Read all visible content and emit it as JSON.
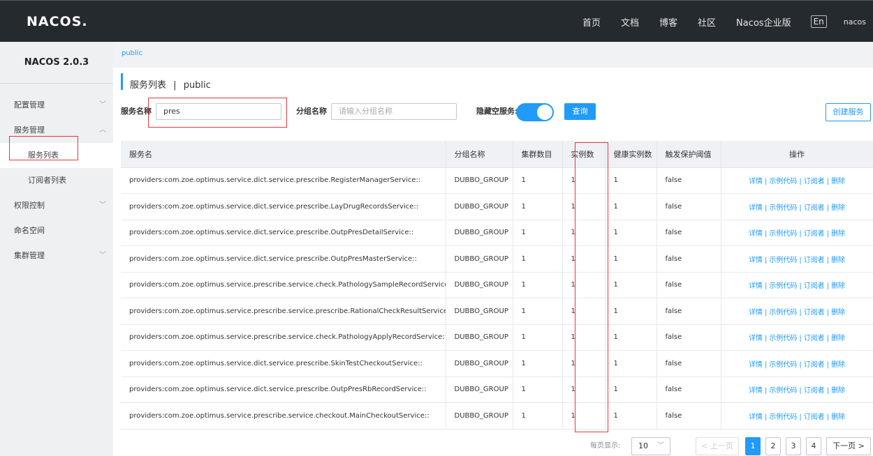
{
  "header": {
    "logo": "NACOS.",
    "nav": [
      "首页",
      "文档",
      "博客",
      "社区",
      "Nacos企业版"
    ],
    "lang": "En",
    "user": "nacos"
  },
  "sidebar": {
    "title": "NACOS 2.0.3",
    "items": [
      {
        "label": "配置管理"
      },
      {
        "label": "服务管理"
      },
      {
        "label": "服务列表"
      },
      {
        "label": "订阅者列表"
      },
      {
        "label": "权限控制"
      },
      {
        "label": "命名空间"
      },
      {
        "label": "集群管理"
      }
    ]
  },
  "breadcrumb": "public",
  "page": {
    "title": "服务列表",
    "sep": "|",
    "namespace": "public"
  },
  "filter": {
    "service_label": "服务名称",
    "service_value": "pres",
    "group_label": "分组名称",
    "group_placeholder": "请输入分组名称",
    "hide_label": "隐藏空服务:",
    "hide_empty": true,
    "query_button": "查询",
    "create_button": "创建服务"
  },
  "table": {
    "headers": [
      "服务名",
      "分组名称",
      "集群数目",
      "实例数",
      "健康实例数",
      "触发保护阈值",
      "操作"
    ],
    "rows": [
      {
        "name": "providers:com.zoe.optimus.service.dict.service.prescribe.RegisterManagerService::",
        "group": "DUBBO_GROUP",
        "clusters": "1",
        "instances": "1",
        "healthy": "1",
        "threshold": "false"
      },
      {
        "name": "providers:com.zoe.optimus.service.dict.service.prescribe.LayDrugRecordsService::",
        "group": "DUBBO_GROUP",
        "clusters": "1",
        "instances": "1",
        "healthy": "1",
        "threshold": "false"
      },
      {
        "name": "providers:com.zoe.optimus.service.dict.service.prescribe.OutpPresDetailService::",
        "group": "DUBBO_GROUP",
        "clusters": "1",
        "instances": "1",
        "healthy": "1",
        "threshold": "false"
      },
      {
        "name": "providers:com.zoe.optimus.service.dict.service.prescribe.OutpPresMasterService::",
        "group": "DUBBO_GROUP",
        "clusters": "1",
        "instances": "1",
        "healthy": "1",
        "threshold": "false"
      },
      {
        "name": "providers:com.zoe.optimus.service.prescribe.service.check.PathologySampleRecordService::",
        "group": "DUBBO_GROUP",
        "clusters": "1",
        "instances": "1",
        "healthy": "1",
        "threshold": "false"
      },
      {
        "name": "providers:com.zoe.optimus.service.prescribe.service.prescribe.RationalCheckResultService::",
        "group": "DUBBO_GROUP",
        "clusters": "1",
        "instances": "1",
        "healthy": "1",
        "threshold": "false"
      },
      {
        "name": "providers:com.zoe.optimus.service.prescribe.service.check.PathologyApplyRecordService::",
        "group": "DUBBO_GROUP",
        "clusters": "1",
        "instances": "1",
        "healthy": "1",
        "threshold": "false"
      },
      {
        "name": "providers:com.zoe.optimus.service.dict.service.prescribe.SkinTestCheckoutService::",
        "group": "DUBBO_GROUP",
        "clusters": "1",
        "instances": "1",
        "healthy": "1",
        "threshold": "false"
      },
      {
        "name": "providers:com.zoe.optimus.service.dict.service.prescribe.OutpPresRbRecordService::",
        "group": "DUBBO_GROUP",
        "clusters": "1",
        "instances": "1",
        "healthy": "1",
        "threshold": "false"
      },
      {
        "name": "providers:com.zoe.optimus.service.prescribe.service.checkout.MainCheckoutService::",
        "group": "DUBBO_GROUP",
        "clusters": "1",
        "instances": "1",
        "healthy": "1",
        "threshold": "false"
      }
    ],
    "ops": [
      "详情",
      "示例代码",
      "订阅者",
      "删除"
    ]
  },
  "pagination": {
    "page_size_label": "每页显示:",
    "page_size": "10",
    "prev": "< 上一页",
    "pages": [
      "1",
      "2",
      "3",
      "4"
    ],
    "current": "1",
    "next": "下一页 >"
  }
}
